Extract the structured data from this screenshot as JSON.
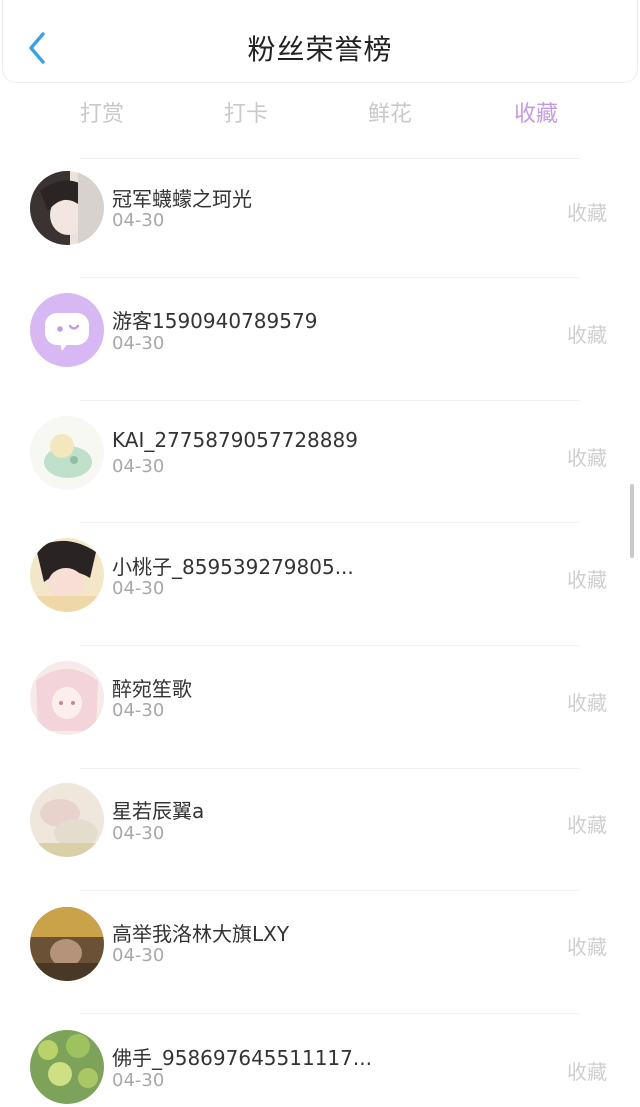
{
  "header": {
    "title": "粉丝荣誉榜"
  },
  "tabs": [
    {
      "label": "打赏"
    },
    {
      "label": "打卡"
    },
    {
      "label": "鲜花"
    },
    {
      "label": "收藏"
    }
  ],
  "active_tab": "收藏",
  "colors": {
    "accent": "#c49be0",
    "muted": "#c9c9c9",
    "back_icon": "#3aa0e8"
  },
  "fans": [
    {
      "name": "冠军蠛蠓之珂光",
      "date": "04-30",
      "action": "收藏"
    },
    {
      "name": "游客1590940789579",
      "date": "04-30",
      "action": "收藏"
    },
    {
      "name": "KAI_2775879057728889",
      "date": "04-30",
      "action": "收藏"
    },
    {
      "name": "小桃子_859539279805...",
      "date": "04-30",
      "action": "收藏"
    },
    {
      "name": "醉宛笙歌",
      "date": "04-30",
      "action": "收藏"
    },
    {
      "name": "星若辰翼a",
      "date": "04-30",
      "action": "收藏"
    },
    {
      "name": "高举我洛林大旗LXY",
      "date": "04-30",
      "action": "收藏"
    },
    {
      "name": "佛手_958697645511117...",
      "date": "04-30",
      "action": "收藏"
    }
  ]
}
